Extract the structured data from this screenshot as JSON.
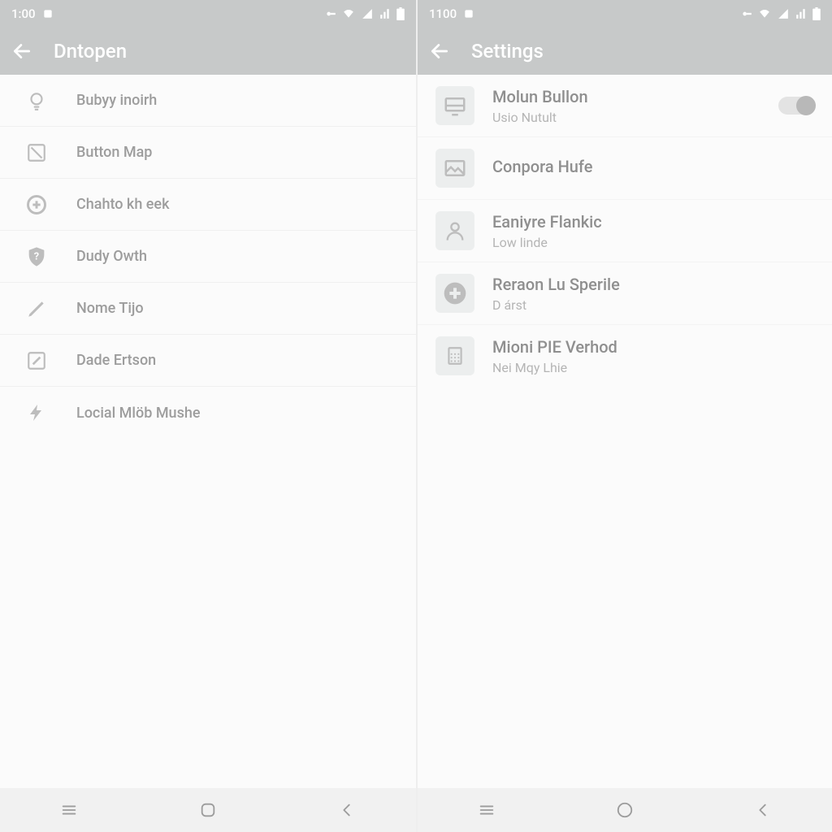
{
  "left": {
    "status_time": "1:00",
    "appbar_title": "Dntopen",
    "items": [
      {
        "label": "Bubyy inoirh"
      },
      {
        "label": "Button Map"
      },
      {
        "label": "Chahto kh eek"
      },
      {
        "label": "Dudy Owth"
      },
      {
        "label": "Nome Tijo"
      },
      {
        "label": "Dade Ertson"
      },
      {
        "label": "Locial Mlöb Mushe"
      }
    ]
  },
  "right": {
    "status_time": "1100",
    "appbar_title": "Settings",
    "items": [
      {
        "title": "Molun Bullon",
        "sub": "Usio Nutult",
        "toggle": true
      },
      {
        "title": "Conpora Hufe",
        "sub": ""
      },
      {
        "title": "Eaniyre Flankic",
        "sub": "Low linde"
      },
      {
        "title": "Reraon Lu Sperile",
        "sub": "D árst"
      },
      {
        "title": "Mioni PIE Verhod",
        "sub": "Nei Mqy Lhie"
      }
    ]
  }
}
